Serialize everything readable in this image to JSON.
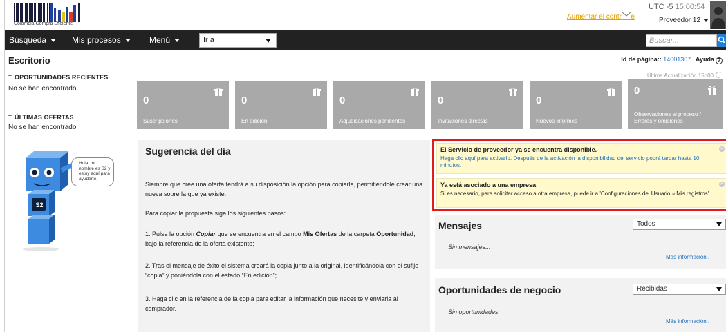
{
  "header": {
    "logo_text": "Colombia Compra Eficiente",
    "contrast_link": "Aumentar el contraste",
    "utc_label": "UTC -5",
    "utc_time": "15:00:54",
    "user_menu": "Proveedor 12"
  },
  "nav": {
    "items": [
      {
        "label": "Búsqueda"
      },
      {
        "label": "Mis procesos"
      },
      {
        "label": "Menú"
      }
    ],
    "goto_label": "Ir a",
    "search_placeholder": "Buscar..."
  },
  "page": {
    "title": "Escritorio",
    "id_label": "Id de página::",
    "id_value": "14001307",
    "help_label": "Ayuda",
    "last_update": "Última Actualización 15h00"
  },
  "left": {
    "recent_title": "OPORTUNIDADES RECIENTES",
    "recent_empty": "No se han encontrado",
    "offers_title": "ÚLTIMAS OFERTAS",
    "offers_empty": "No se han encontrado"
  },
  "tiles": [
    {
      "count": "0",
      "label": "Suscripciones"
    },
    {
      "count": "0",
      "label": "En edición"
    },
    {
      "count": "0",
      "label": "Adjudicaciones pendientes"
    },
    {
      "count": "0",
      "label": "Invitaciones directas"
    },
    {
      "count": "0",
      "label": "Nuevos informes"
    },
    {
      "count": "0",
      "label": "Observaciones al proceso / Errores y omisiones"
    }
  ],
  "mascot": {
    "bubble": "Hola, mi nombre es S2 y estoy aquí para ayudarte.",
    "badge": "S2"
  },
  "suggestion": {
    "title": "Sugerencia del día",
    "p1": "Siempre que cree una oferta tendrá a su disposición la opción para copiarla, permitiéndole crear una nueva sobre la que ya existe.",
    "p2": "Para copiar la propuesta siga los siguientes pasos:",
    "s1_a": "1. Pulse la opción ",
    "s1_b": "Copiar",
    "s1_c": " que se encuentra en el campo ",
    "s1_d": "Mis Ofertas",
    "s1_e": " de la carpeta ",
    "s1_f": "Oportunidad",
    "s1_g": ", bajo la referencia de la oferta existente;",
    "s2": "2. Tras el mensaje de éxito el sistema creará la copia junto a la original, identificándola con el sufijo “copia” y poniéndola con el estado “En edición”;",
    "s3": "3. Haga clic en la referencia de la copia para editar la información que necesite y enviarla al comprador."
  },
  "alerts": [
    {
      "title": "El Servicio de proveedor ya se encuentra disponible.",
      "body": "Haga clic aquí para activarlo. Después de la activación la disponibilidad del servicio podrá tardar hasta 10 minutos."
    },
    {
      "title": "Ya está asociado a una empresa",
      "body": "Si es necesario, para solicitar acceso a otra empresa, puede ir a 'Configuraciones del Usuario » Mis registros'."
    }
  ],
  "messages": {
    "title": "Mensajes",
    "filter": "Todos",
    "empty": "Sin mensajes...",
    "more": "Más información ."
  },
  "opportunities": {
    "title": "Oportunidades de negocio",
    "filter": "Recibidas",
    "empty": "Sin oportunidades",
    "more": "Más información ."
  },
  "colors": {
    "nav_bg": "#222222",
    "tile_bg": "#a9a9a9",
    "alert_bg": "#fff9cc",
    "alert_border": "#e01b1b",
    "link": "#1f6fbf",
    "contrast_link": "#e6a000",
    "search_button": "#1f7fd6"
  }
}
